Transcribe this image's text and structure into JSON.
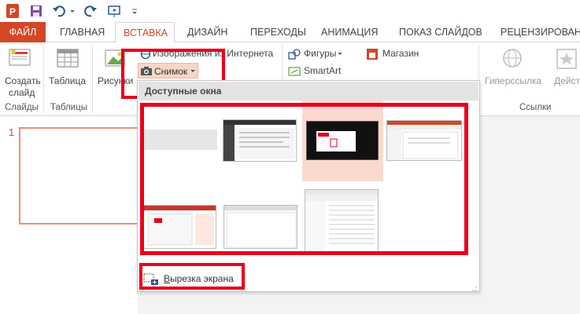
{
  "tabs": {
    "file": "ФАЙЛ",
    "home": "ГЛАВНАЯ",
    "insert": "ВСТАВКА",
    "design": "ДИЗАЙН",
    "transitions": "ПЕРЕХОДЫ",
    "animation": "АНИМАЦИЯ",
    "slideshow": "ПОКАЗ СЛАЙДОВ",
    "review": "РЕЦЕНЗИРОВАНИ"
  },
  "ribbon": {
    "new_slide_line1": "Создать",
    "new_slide_line2": "слайд",
    "table": "Таблица",
    "pictures": "Рисунки",
    "online_pictures": "Изображения из Интернета",
    "screenshot": "Снимок",
    "shapes": "Фигуры",
    "smartart": "SmartArt",
    "store": "Магазин",
    "hyperlink": "Гиперссылка",
    "action": "Действи",
    "group_slides": "Слайды",
    "group_tables": "Таблицы",
    "group_links": "Ссылки"
  },
  "slide_pane": {
    "slide_number": "1"
  },
  "dropdown": {
    "header": "Доступные окна",
    "clip_label_underlined": "В",
    "clip_label_rest": "ырезка экрана"
  },
  "colors": {
    "accent": "#d24726",
    "highlight": "#e8001c"
  }
}
